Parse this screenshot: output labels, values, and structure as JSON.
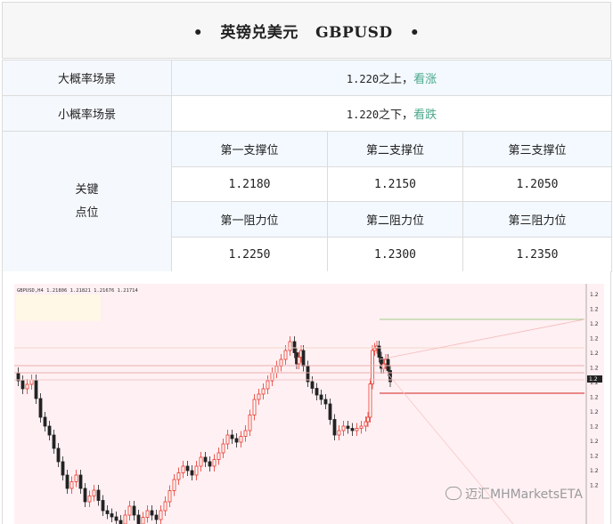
{
  "title": "•   英镑兑美元   GBPUSD   •",
  "rows": {
    "major": {
      "label": "大概率场景",
      "level": "1.220",
      "dir": "之上，",
      "view": "看涨"
    },
    "minor": {
      "label": "小概率场景",
      "level": "1.220",
      "dir": "之下，",
      "view": "看跌"
    },
    "key": {
      "label_line1": "关键",
      "label_line2": "点位"
    }
  },
  "supports": {
    "headers": [
      "第一支撑位",
      "第二支撑位",
      "第三支撑位"
    ],
    "values": [
      "1.2180",
      "1.2150",
      "1.2050"
    ]
  },
  "resistances": {
    "headers": [
      "第一阻力位",
      "第二阻力位",
      "第三阻力位"
    ],
    "values": [
      "1.2250",
      "1.2300",
      "1.2350"
    ]
  },
  "chart": {
    "header_text": "GBPUSD,H4  1.21806 1.21821 1.21676 1.21714",
    "axis_ticks": [
      "1.2",
      "1.2",
      "1.2",
      "1.2",
      "1.2",
      "1.2",
      "1.2",
      "1.2",
      "1.2",
      "1.2",
      "1.2",
      "1.2",
      "1.2",
      "1.2"
    ],
    "price_label": "1.2",
    "colors": {
      "bg": "#fff0f3",
      "bull": "#e8382c",
      "bear": "#222222",
      "support": "#d94a4a",
      "resist_green": "#a0cc88",
      "hline": "#e8b0b0"
    }
  },
  "watermark": "迈汇MHMarketsETA",
  "watermark_icon": "wechat-icon"
}
